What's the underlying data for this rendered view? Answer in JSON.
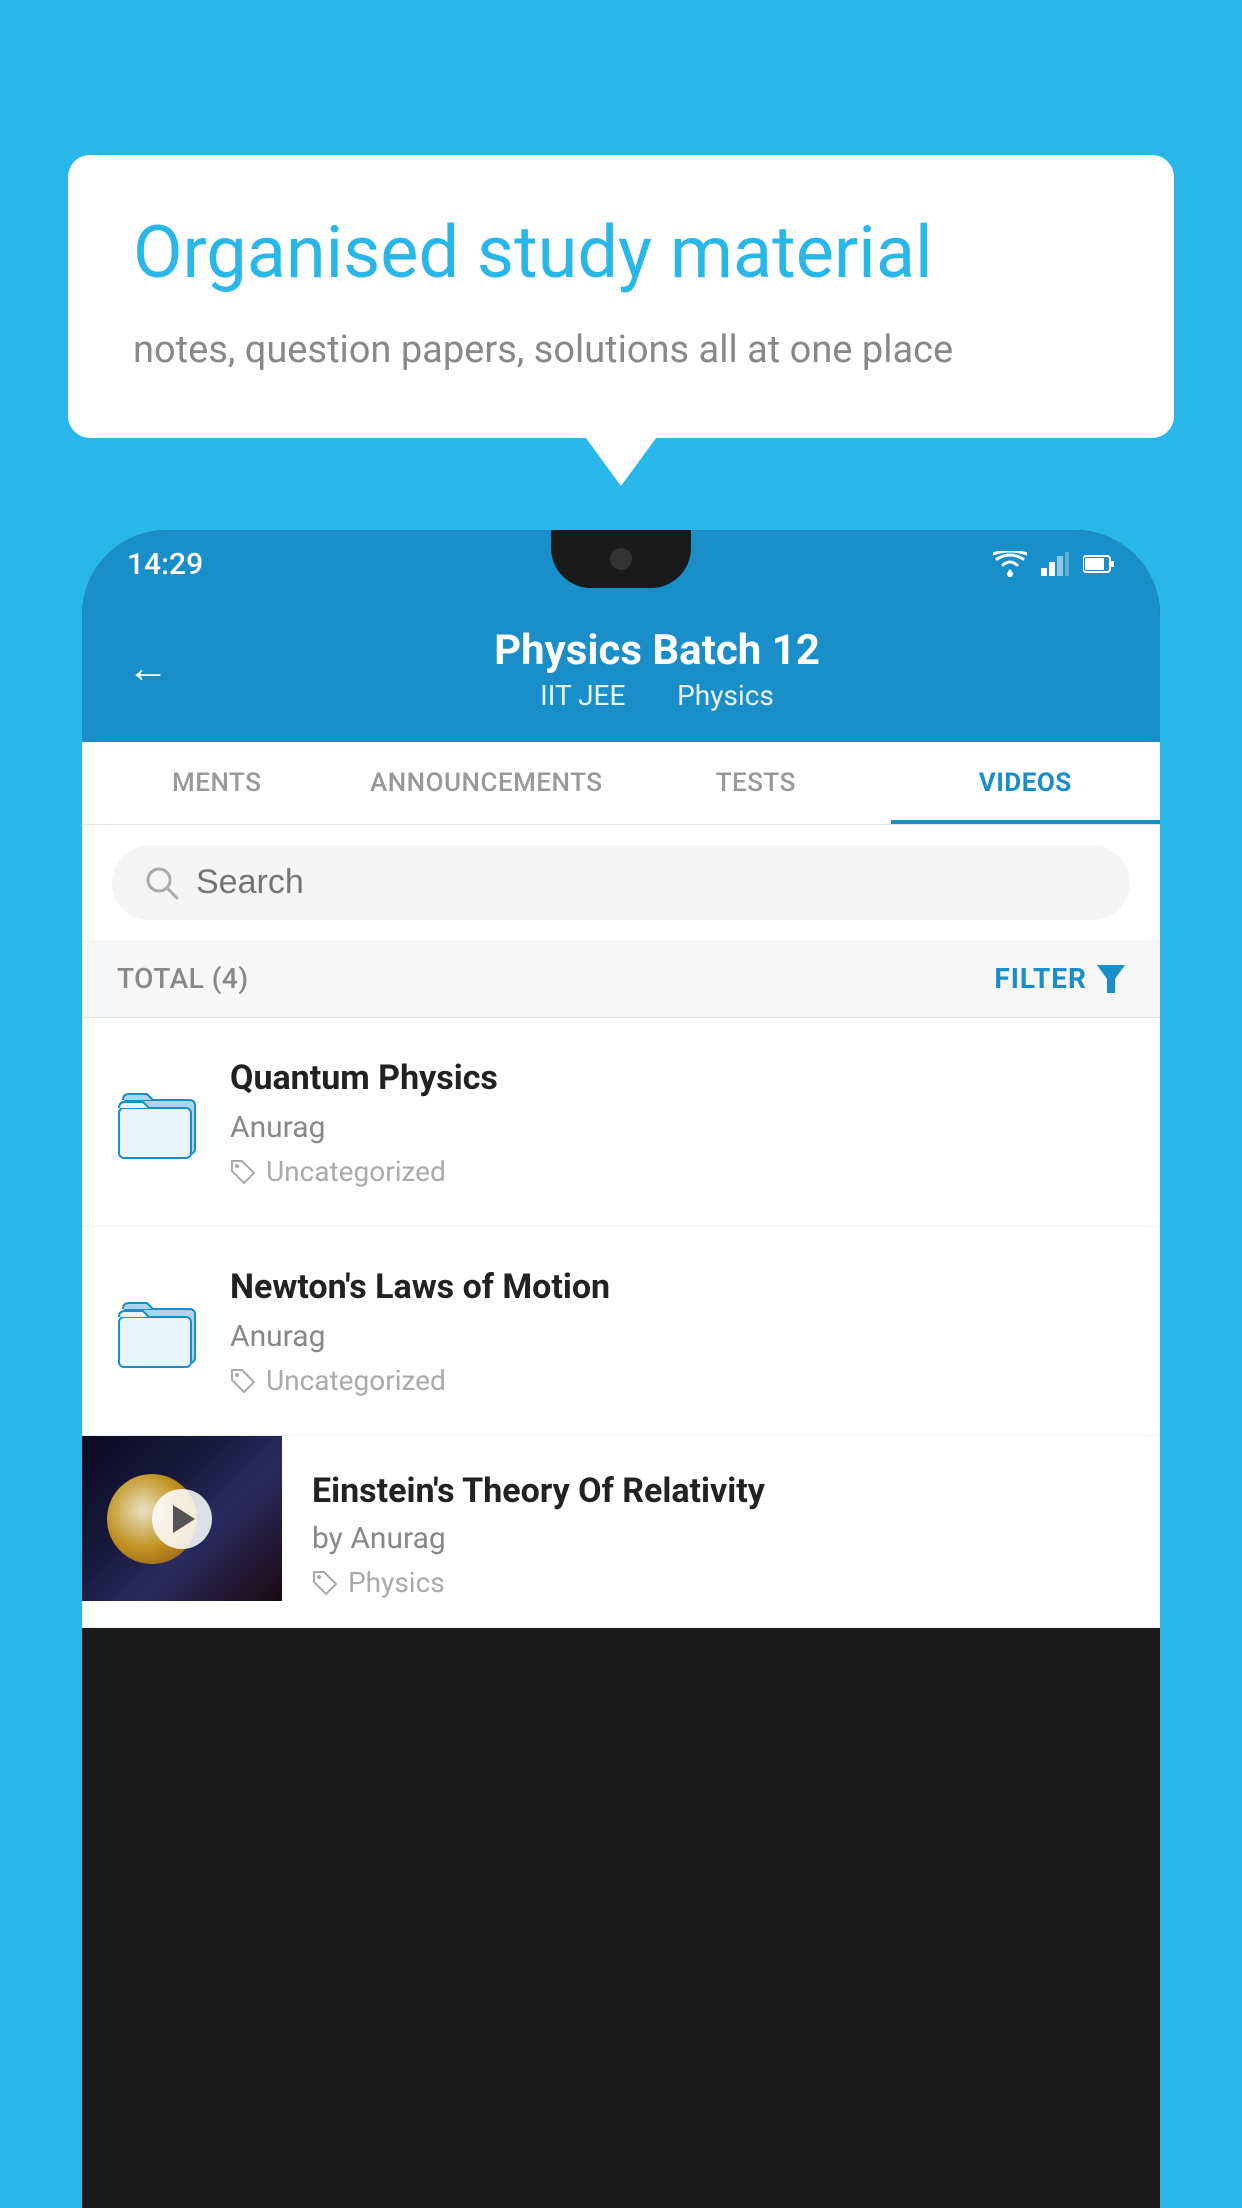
{
  "background_color": "#29b6e8",
  "speech_bubble": {
    "title": "Organised study material",
    "subtitle": "notes, question papers, solutions all at one place"
  },
  "phone": {
    "status_bar": {
      "time": "14:29",
      "icons": [
        "wifi",
        "signal",
        "battery"
      ]
    },
    "header": {
      "back_label": "←",
      "title": "Physics Batch 12",
      "subtitle_1": "IIT JEE",
      "subtitle_2": "Physics"
    },
    "tabs": [
      {
        "label": "MENTS",
        "active": false
      },
      {
        "label": "ANNOUNCEMENTS",
        "active": false
      },
      {
        "label": "TESTS",
        "active": false
      },
      {
        "label": "VIDEOS",
        "active": true
      }
    ],
    "search": {
      "placeholder": "Search"
    },
    "filter_row": {
      "total_label": "TOTAL (4)",
      "filter_label": "FILTER"
    },
    "videos": [
      {
        "id": 1,
        "title": "Quantum Physics",
        "author": "Anurag",
        "tag": "Uncategorized",
        "has_thumbnail": false
      },
      {
        "id": 2,
        "title": "Newton's Laws of Motion",
        "author": "Anurag",
        "tag": "Uncategorized",
        "has_thumbnail": false
      }
    ],
    "einstein_video": {
      "title": "Einstein's Theory Of Relativity",
      "author": "by Anurag",
      "tag": "Physics"
    }
  }
}
